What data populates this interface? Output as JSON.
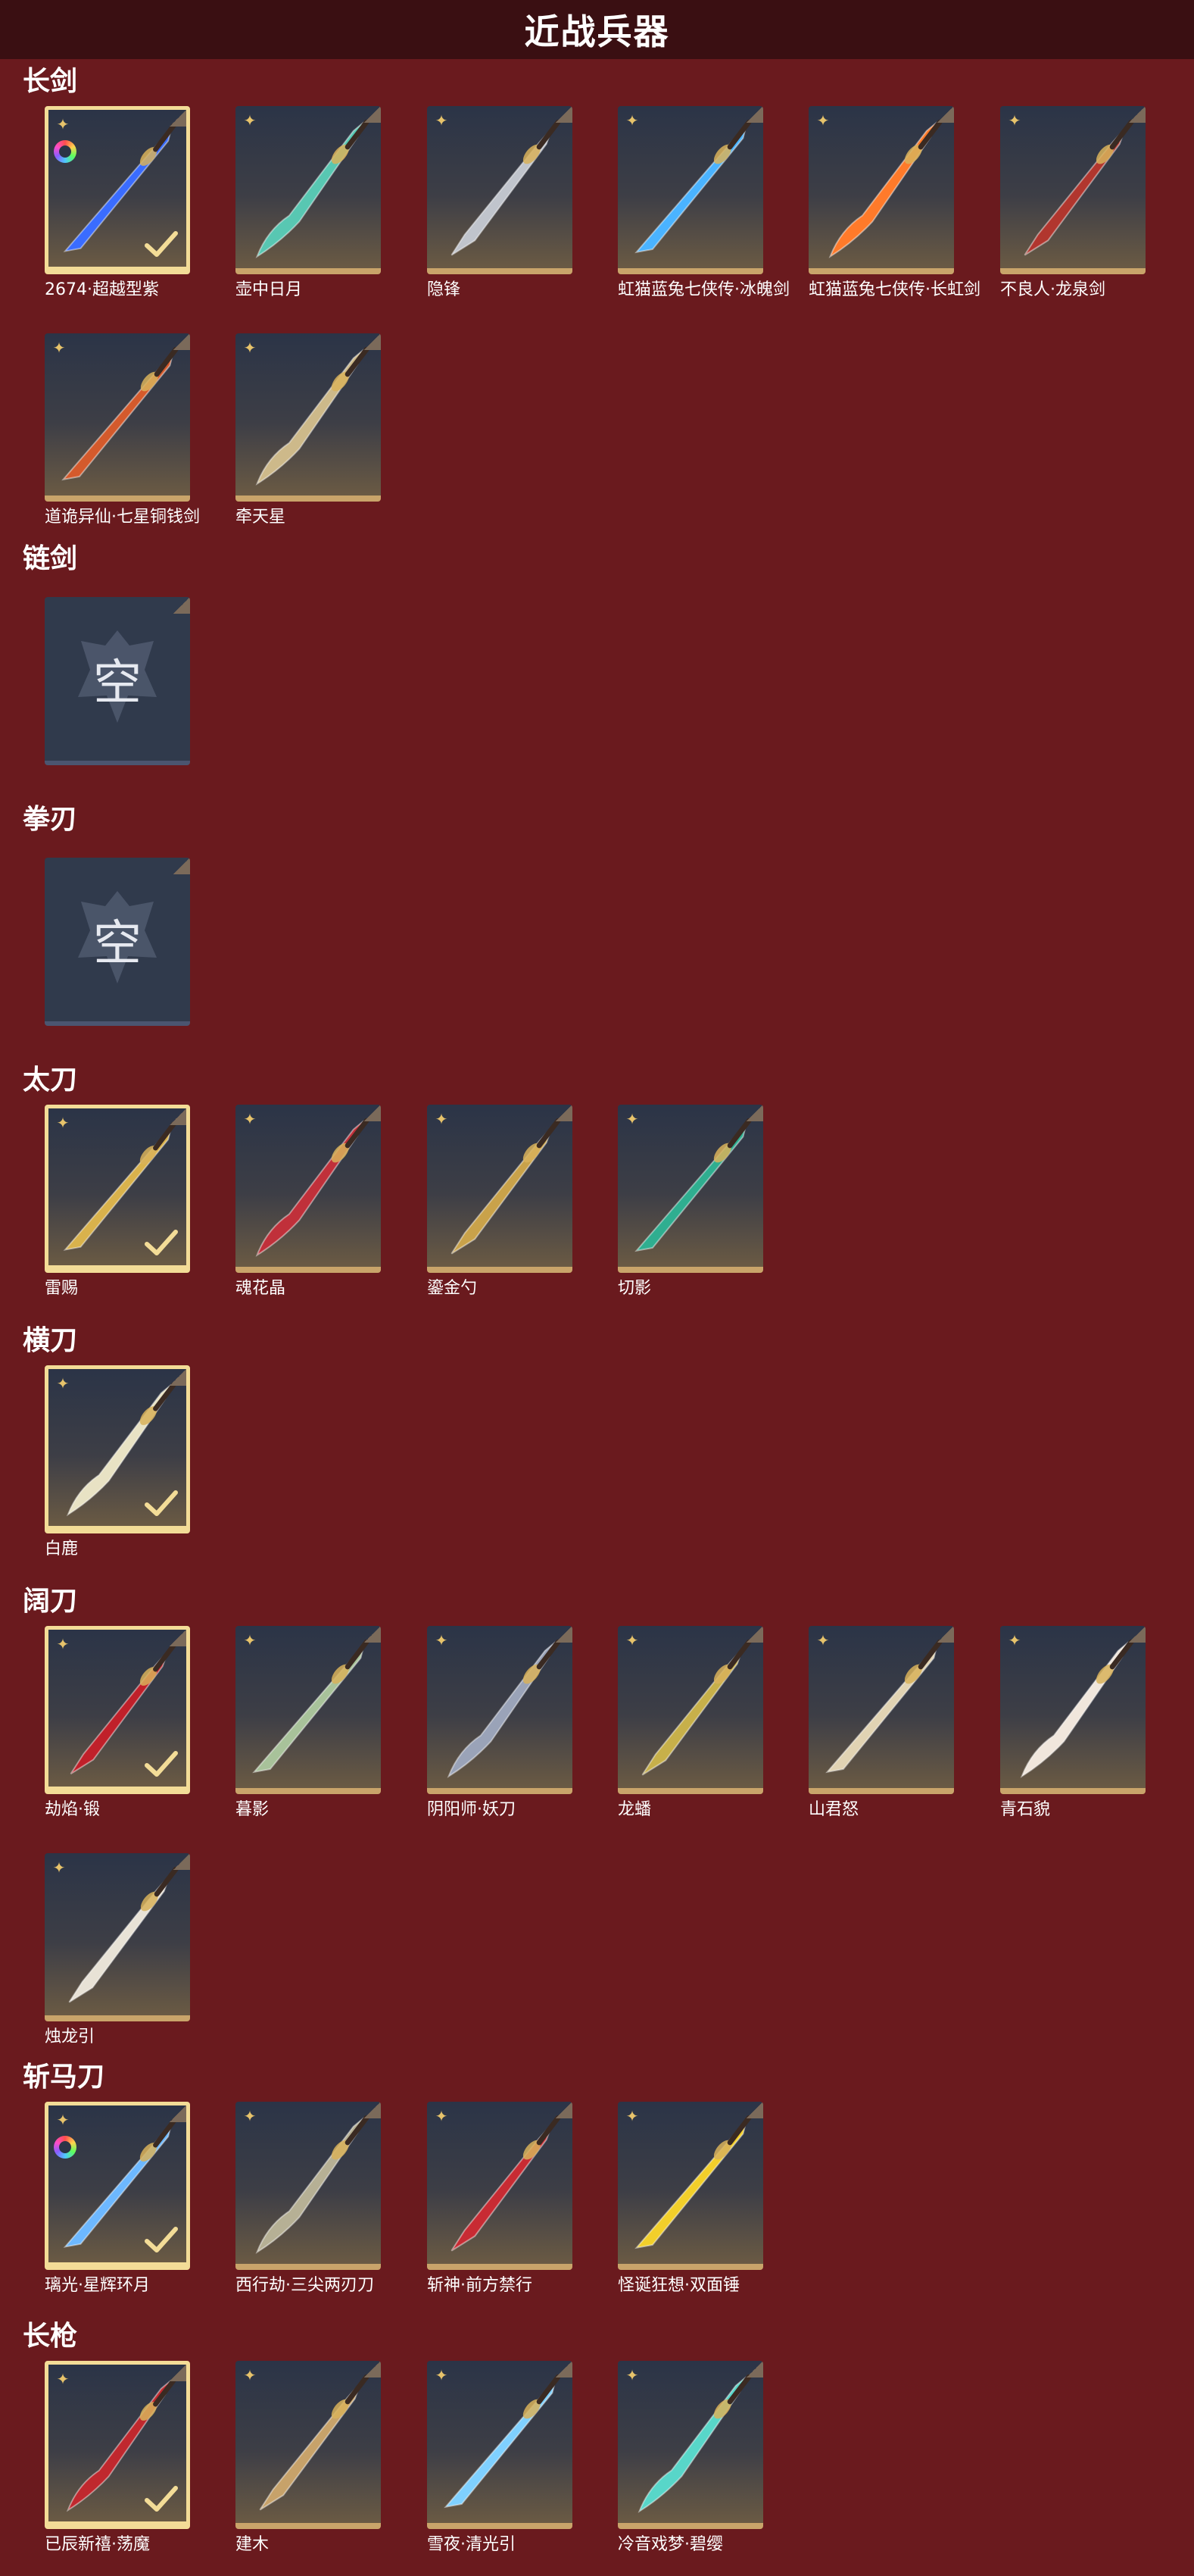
{
  "header": {
    "title": "近战兵器"
  },
  "sections": [
    {
      "title": "长剑",
      "items": [
        {
          "name": "2674·超越型紫",
          "selected": true,
          "color": "#3a6cff"
        },
        {
          "name": "壶中日月",
          "selected": false,
          "color": "#58c7b2"
        },
        {
          "name": "隐锋",
          "selected": false,
          "color": "#c0c4cc"
        },
        {
          "name": "虹猫蓝兔七侠传·冰魄剑",
          "selected": false,
          "color": "#4ab3ff"
        },
        {
          "name": "虹猫蓝兔七侠传·长虹剑",
          "selected": false,
          "color": "#ff7a2a"
        },
        {
          "name": "不良人·龙泉剑",
          "selected": false,
          "color": "#b1362e"
        },
        {
          "name": "道诡异仙·七星铜钱剑",
          "selected": false,
          "color": "#d45a2c"
        },
        {
          "name": "牵天星",
          "selected": false,
          "color": "#cdb98a"
        }
      ]
    },
    {
      "title": "链剑",
      "empty": "空"
    },
    {
      "title": "拳刃",
      "empty": "空"
    },
    {
      "title": "太刀",
      "items": [
        {
          "name": "雷赐",
          "selected": true,
          "color": "#d9b24c"
        },
        {
          "name": "魂花晶",
          "selected": false,
          "color": "#c0303a"
        },
        {
          "name": "鎏金勺",
          "selected": false,
          "color": "#c9a24a"
        },
        {
          "name": "切影",
          "selected": false,
          "color": "#2fae90"
        }
      ]
    },
    {
      "title": "横刀",
      "items": [
        {
          "name": "白鹿",
          "selected": true,
          "color": "#e8e2c4"
        }
      ]
    },
    {
      "title": "阔刀",
      "items": [
        {
          "name": "劫焰·锻",
          "selected": true,
          "color": "#c0202a"
        },
        {
          "name": "暮影",
          "selected": false,
          "color": "#a8c29a"
        },
        {
          "name": "阴阳师·妖刀",
          "selected": false,
          "color": "#9aa3b8"
        },
        {
          "name": "龙蟠",
          "selected": false,
          "color": "#c7b04a"
        },
        {
          "name": "山君怒",
          "selected": false,
          "color": "#e1d3b3"
        },
        {
          "name": "青石貌",
          "selected": false,
          "color": "#f0e6dc"
        },
        {
          "name": "烛龙引",
          "selected": false,
          "color": "#e8e2d6"
        }
      ]
    },
    {
      "title": "斩马刀",
      "items": [
        {
          "name": "璃光·星辉环月",
          "selected": true,
          "color": "#6db8ff"
        },
        {
          "name": "西行劫·三尖两刃刀",
          "selected": false,
          "color": "#b6b095"
        },
        {
          "name": "斩神·前方禁行",
          "selected": false,
          "color": "#c82b33"
        },
        {
          "name": "怪诞狂想·双面锤",
          "selected": false,
          "color": "#f2cf2a"
        }
      ]
    },
    {
      "title": "长枪",
      "items": [
        {
          "name": "已辰新禧·荡魔",
          "selected": true,
          "color": "#c0282e"
        },
        {
          "name": "建木",
          "selected": false,
          "color": "#c7a26a"
        },
        {
          "name": "雪夜·清光引",
          "selected": false,
          "color": "#7fd0ff"
        },
        {
          "name": "冷音戏梦·碧缨",
          "selected": false,
          "color": "#58d6c9"
        }
      ]
    }
  ]
}
